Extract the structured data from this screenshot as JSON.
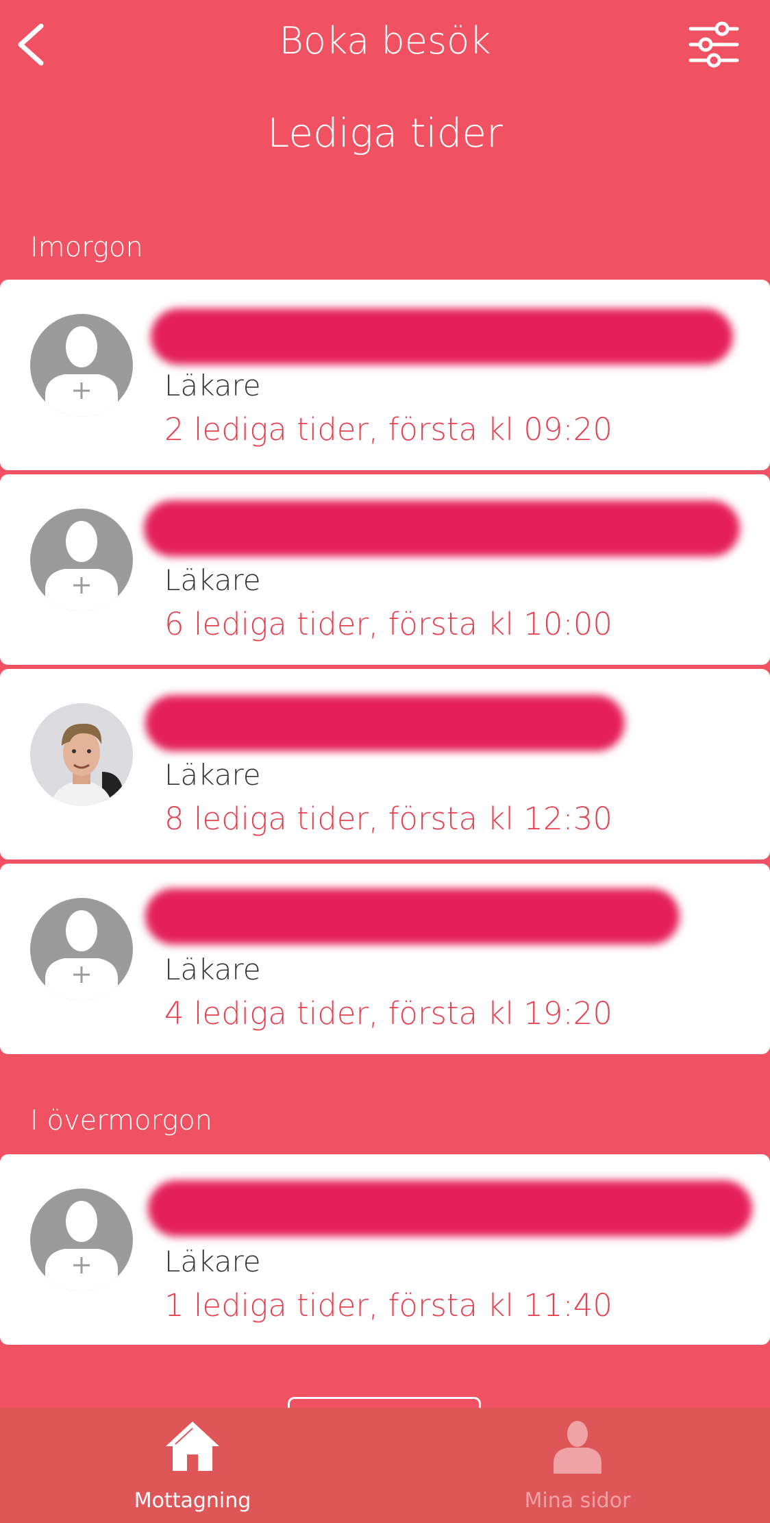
{
  "header": {
    "title": "Boka besök",
    "subtitle": "Lediga tider"
  },
  "sections": [
    {
      "label": "Imorgon",
      "cards": [
        {
          "role": "Läkare",
          "slots": "2 lediga tider, första kl 09:20",
          "avatar": "default-avatar"
        },
        {
          "role": "Läkare",
          "slots": "6 lediga tider, första kl 10:00",
          "avatar": "default-avatar"
        },
        {
          "role": "Läkare",
          "slots": "8 lediga tider, första kl 12:30",
          "avatar": "photo-avatar"
        },
        {
          "role": "Läkare",
          "slots": "4 lediga tider, första kl 19:20",
          "avatar": "default-avatar"
        }
      ]
    },
    {
      "label": "I övermorgon",
      "cards": [
        {
          "role": "Läkare",
          "slots": "1 lediga tider, första kl 11:40",
          "avatar": "default-avatar"
        }
      ]
    }
  ],
  "tabbar": {
    "tabs": [
      {
        "label": "Mottagning",
        "icon": "home-icon",
        "active": true
      },
      {
        "label": "Mina sidor",
        "icon": "person-icon",
        "active": false
      }
    ]
  },
  "colors": {
    "background": "#F05263",
    "accent_text": "#E8404F",
    "redaction": "#E41F5A",
    "tabbar": "#DF5659"
  }
}
